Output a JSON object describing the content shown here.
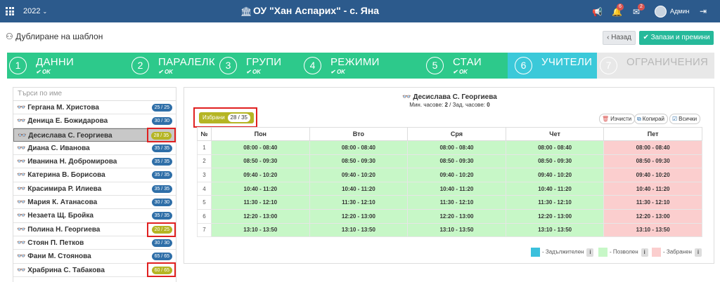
{
  "topbar": {
    "year": "2022",
    "title": "ОУ \"Хан Аспарих\" - с. Яна",
    "notif_count_1": "6",
    "notif_count_2": "2",
    "user": "Админ"
  },
  "page": {
    "title": "Дублиране на шаблон",
    "back_label": "Назад",
    "save_label": "Запази и премини"
  },
  "steps": [
    {
      "num": "1",
      "label": "ДАННИ",
      "status": "OK"
    },
    {
      "num": "2",
      "label": "ПАРАЛЕЛКИ",
      "status": "OK"
    },
    {
      "num": "3",
      "label": "ГРУПИ",
      "status": "OK"
    },
    {
      "num": "4",
      "label": "РЕЖИМИ",
      "status": "OK"
    },
    {
      "num": "5",
      "label": "СТАИ",
      "status": "OK"
    },
    {
      "num": "6",
      "label": "УЧИТЕЛИ",
      "status": ""
    },
    {
      "num": "7",
      "label": "ОГРАНИЧЕНИЯ",
      "status": ""
    }
  ],
  "sidebar": {
    "search_placeholder": "Търси по име",
    "teachers": [
      {
        "name": "Гергана М. Христова",
        "count": "25 / 25"
      },
      {
        "name": "Деница Е. Божидарова",
        "count": "30 / 30"
      },
      {
        "name": "Десислава С. Георгиева",
        "count": "28 / 35"
      },
      {
        "name": "Диана С. Иванова",
        "count": "35 / 35"
      },
      {
        "name": "Иванина Н. Добромирова",
        "count": "35 / 35"
      },
      {
        "name": "Катерина В. Борисова",
        "count": "35 / 35"
      },
      {
        "name": "Красимира Р. Илиева",
        "count": "35 / 35"
      },
      {
        "name": "Мария К. Атанасова",
        "count": "30 / 30"
      },
      {
        "name": "Незаета Щ. Бройка",
        "count": "35 / 35"
      },
      {
        "name": "Полина Н. Георгиева",
        "count": "20 / 25"
      },
      {
        "name": "Стоян П. Петков",
        "count": "30 / 30"
      },
      {
        "name": "Фани М. Стоянова",
        "count": "65 / 65"
      },
      {
        "name": "Храбрина С. Табакова",
        "count": "60 / 65"
      }
    ]
  },
  "panel": {
    "teacher": "Десислава С. Георгиева",
    "min_label": "Мин. часове:",
    "min_value": "2",
    "sep": " / ",
    "max_label": "Зад. часове:",
    "max_value": "0",
    "selected_label": "Избрани",
    "selected_count": "28 / 35",
    "clear_label": "Изчисти",
    "copy_label": "Копирай",
    "all_label": "Всички"
  },
  "schedule": {
    "col_no": "№",
    "days": [
      "Пон",
      "Вто",
      "Сря",
      "Чет",
      "Пет"
    ],
    "rows": [
      {
        "n": "1",
        "time": "08:00 - 08:40"
      },
      {
        "n": "2",
        "time": "08:50 - 09:30"
      },
      {
        "n": "3",
        "time": "09:40 - 10:20"
      },
      {
        "n": "4",
        "time": "10:40 - 11:20"
      },
      {
        "n": "5",
        "time": "11:30 - 12:10"
      },
      {
        "n": "6",
        "time": "12:20 - 13:00"
      },
      {
        "n": "7",
        "time": "13:10 - 13:50"
      }
    ]
  },
  "legend": {
    "required": "- Задължителен",
    "allowed": "- Позволен",
    "forbidden": "- Забранен",
    "required_color": "#3bc0dc",
    "allowed_color": "#c7f7c7",
    "forbidden_color": "#fbcece"
  }
}
